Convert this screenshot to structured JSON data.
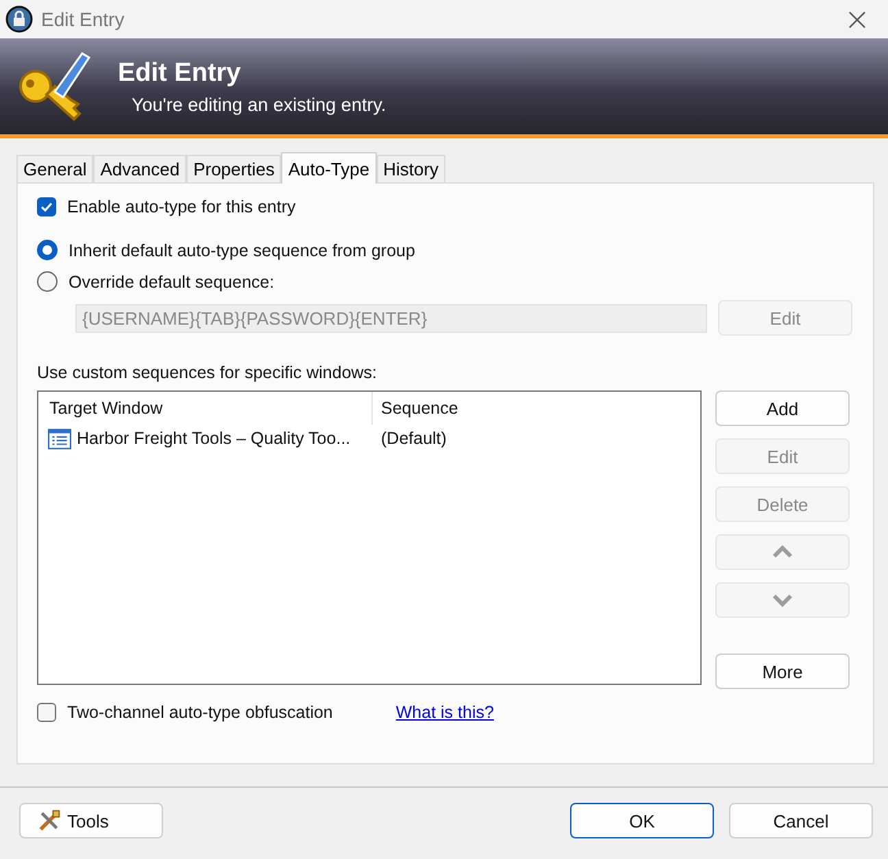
{
  "window": {
    "title": "Edit Entry"
  },
  "header": {
    "title": "Edit Entry",
    "subtitle": "You're editing an existing entry."
  },
  "tabs": [
    {
      "label": "General",
      "selected": false
    },
    {
      "label": "Advanced",
      "selected": false
    },
    {
      "label": "Properties",
      "selected": false
    },
    {
      "label": "Auto-Type",
      "selected": true
    },
    {
      "label": "History",
      "selected": false
    }
  ],
  "enable_autotype": {
    "label": "Enable auto-type for this entry",
    "checked": true
  },
  "sequence_options": [
    {
      "label": "Inherit default auto-type sequence from group",
      "selected": true
    },
    {
      "label": "Override default sequence:",
      "selected": false
    }
  ],
  "sequence_field": {
    "value": "{USERNAME}{TAB}{PASSWORD}{ENTER}",
    "disabled": true
  },
  "sequence_edit_button": {
    "label": "Edit",
    "disabled": true
  },
  "custom_label": "Use custom sequences for specific windows:",
  "table": {
    "columns": [
      "Target Window",
      "Sequence"
    ],
    "rows": [
      {
        "target_window": "Harbor Freight Tools – Quality Too...",
        "sequence": "(Default)"
      }
    ]
  },
  "side_buttons": [
    {
      "kind": "text",
      "label": "Add",
      "disabled": false
    },
    {
      "kind": "text",
      "label": "Edit",
      "disabled": true
    },
    {
      "kind": "text",
      "label": "Delete",
      "disabled": true
    },
    {
      "kind": "up",
      "disabled": true
    },
    {
      "kind": "down",
      "disabled": true
    },
    {
      "kind": "text",
      "label": "More",
      "disabled": false
    }
  ],
  "two_channel": {
    "label": "Two-channel auto-type obfuscation",
    "checked": false
  },
  "help_link": "What is this?",
  "footer": {
    "tools": "Tools",
    "ok": "OK",
    "cancel": "Cancel"
  }
}
